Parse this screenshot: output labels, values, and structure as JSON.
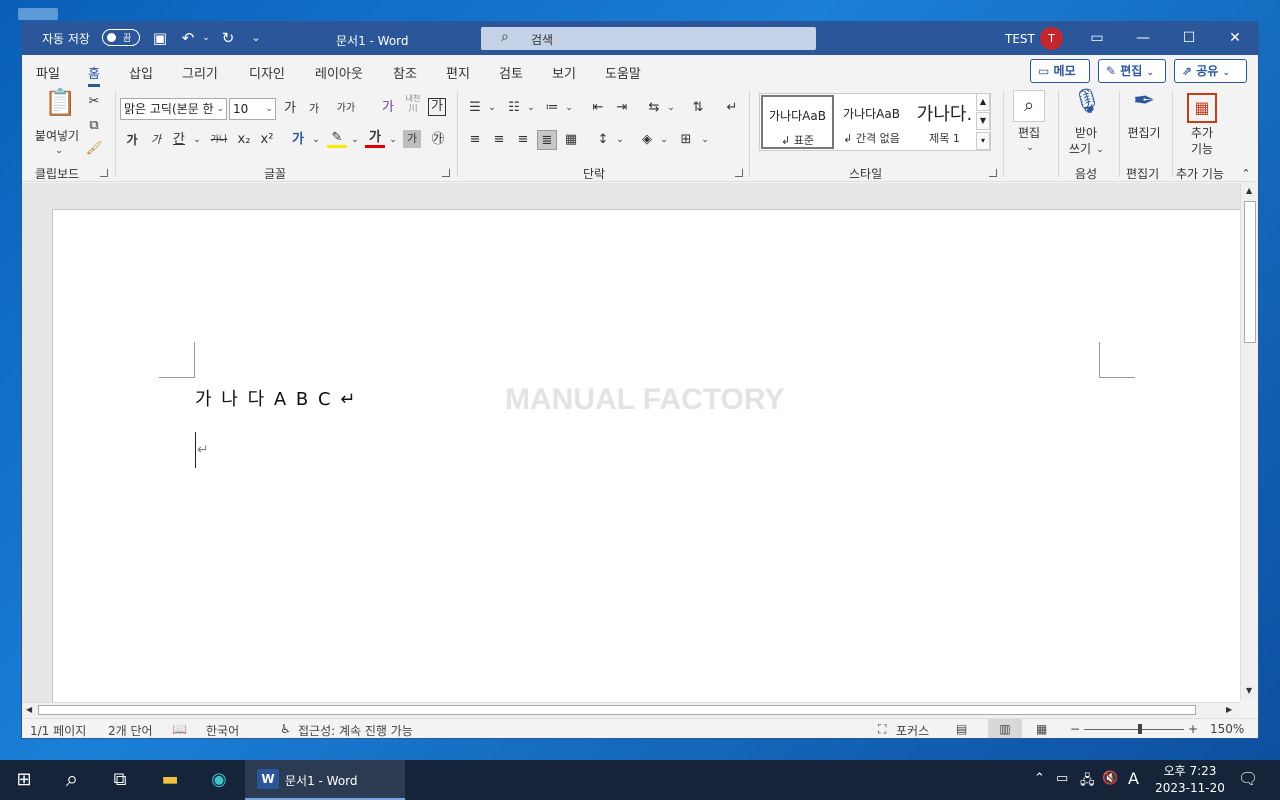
{
  "titlebar": {
    "autosave_label": "자동 저장",
    "autosave_state": "끔",
    "doc_title": "문서1  -  Word",
    "search_placeholder": "검색",
    "user_name": "TEST",
    "user_initial": "T"
  },
  "tabs": [
    "파일",
    "홈",
    "삽입",
    "그리기",
    "디자인",
    "레이아웃",
    "참조",
    "편지",
    "검토",
    "보기",
    "도움말"
  ],
  "active_tab": "홈",
  "right_buttons": {
    "comments": "메모",
    "editing": "편집",
    "share": "공유"
  },
  "ribbon": {
    "clipboard": {
      "paste_label": "붙여넣기",
      "group": "클립보드"
    },
    "font": {
      "font_name": "맑은 고딕(본문 한",
      "font_size": "10",
      "grow": "가",
      "shrink": "가",
      "case": "가가",
      "phonetic": "가",
      "hanja_top": "내천",
      "hanja_bottom": "川",
      "enclose": "가",
      "bold": "가",
      "italic": "가",
      "underline": "간",
      "strike": "가나",
      "subscript": "x₂",
      "superscript": "x²",
      "effects": "가",
      "highlight": "✎",
      "font_color": "가",
      "shade": "가",
      "circle": "㉮",
      "group": "글꼴"
    },
    "paragraph": {
      "group": "단락"
    },
    "styles": {
      "items": [
        {
          "sample": "가나다AaB",
          "name": "↲ 표준"
        },
        {
          "sample": "가나다AaB",
          "name": "↲ 간격 없음"
        },
        {
          "sample": "가나다.",
          "name": "제목 1"
        }
      ],
      "group": "스타일"
    },
    "editing": {
      "label": "편집"
    },
    "voice": {
      "label_line1": "받아",
      "label_line2": "쓰기",
      "group": "음성"
    },
    "editor": {
      "label": "편집기",
      "group": "편집기"
    },
    "addins": {
      "label_line1": "추가",
      "label_line2": "기능",
      "group": "추가 기능"
    }
  },
  "document": {
    "line1": "가 나 다   A B C ↵",
    "line2": "↵",
    "watermark": "MANUAL FACTORY"
  },
  "statusbar": {
    "page": "1/1 페이지",
    "words": "2개 단어",
    "language": "한국어",
    "accessibility": "접근성: 계속 진행 가능",
    "focus": "포커스",
    "zoom": "150%"
  },
  "taskbar": {
    "word_task": "문서1 - Word",
    "time": "오후 7:23",
    "date": "2023-11-20",
    "ime": "A"
  },
  "colors": {
    "word_blue": "#2b579a",
    "avatar": "#c4262e",
    "taskbar": "#16243a"
  }
}
